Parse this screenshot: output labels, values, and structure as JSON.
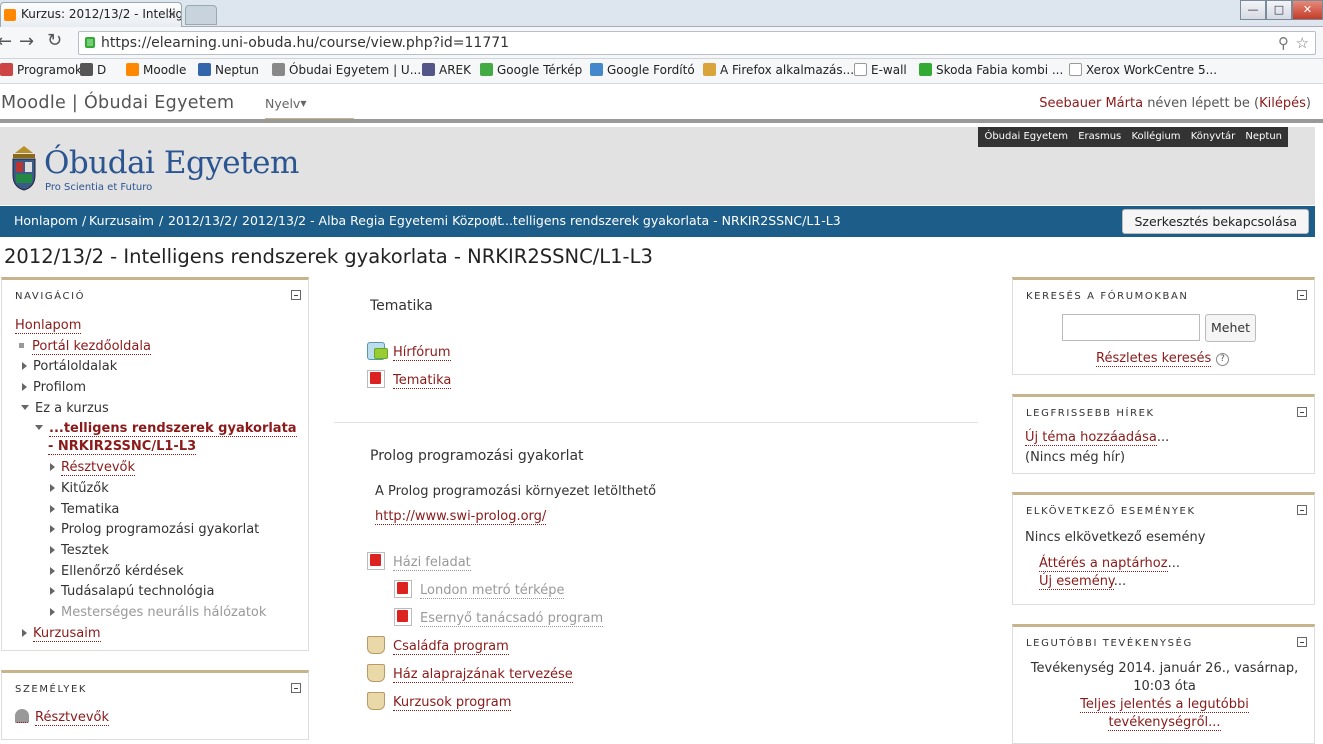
{
  "browser": {
    "tab_title": "Kurzus: 2012/13/2 - Intellig",
    "tab_close": "×",
    "url": "https://elearning.uni-obuda.hu/course/view.php?id=11771",
    "window_buttons": [
      "—",
      "□",
      "✕"
    ],
    "bookmarks": [
      {
        "label": "Programok",
        "color": "#c44"
      },
      {
        "label": "D",
        "color": "#555"
      },
      {
        "label": "Moodle",
        "color": "#f80"
      },
      {
        "label": "Neptun",
        "color": "#36a"
      },
      {
        "label": "Óbudai Egyetem | U...",
        "color": "#888"
      },
      {
        "label": "AREK",
        "color": "#558"
      },
      {
        "label": "Google Térkép",
        "color": "#4a4"
      },
      {
        "label": "Google Fordító",
        "color": "#48c"
      },
      {
        "label": "A Firefox alkalmazás...",
        "color": "#d9a53a"
      },
      {
        "label": "E-wall",
        "color": "#ccc"
      },
      {
        "label": "Skoda Fabia kombi ...",
        "color": "#3a3"
      },
      {
        "label": "Xerox WorkCentre 5...",
        "color": "#ccc"
      }
    ]
  },
  "header": {
    "site_title": "Moodle | Óbudai Egyetem",
    "language": "Nyelv",
    "user_name": "Seebauer Márta",
    "logged_in_text": "néven lépett be (",
    "logout": "Kilépés",
    "logout_close": ")"
  },
  "toplinks": [
    "Óbudai Egyetem",
    "Erasmus",
    "Kollégium",
    "Könyvtár",
    "Neptun"
  ],
  "logo": {
    "name": "Óbudai Egyetem",
    "motto": "Pro Scientia et Futuro"
  },
  "breadcrumb": [
    "Honlapom",
    "Kurzusaim",
    "2012/13/2",
    "2012/13/2 - Alba Regia Egyetemi Központ",
    "...telligens rendszerek gyakorlata - NRKIR2SSNC/L1-L3"
  ],
  "edit_button": "Szerkesztés bekapcsolása",
  "page_title": "2012/13/2 - Intelligens rendszerek gyakorlata - NRKIR2SSNC/L1-L3",
  "navigation": {
    "title": "NAVIGÁCIÓ",
    "home": "Honlapom",
    "portal": "Portál kezdőoldala",
    "portal_pages": "Portáloldalak",
    "profile": "Profilom",
    "this_course": "Ez a kurzus",
    "course_line1": "...telligens rendszerek gyakorlata",
    "course_line2": "- NRKIR2SSNC/L1-L3",
    "items": [
      "Résztvevők",
      "Kitűzők",
      "Tematika",
      "Prolog programozási gyakorlat",
      "Tesztek",
      "Ellenőrző kérdések",
      "Tudásalapú technológia",
      "Mesterséges neurális hálózatok"
    ],
    "my_courses": "Kurzusaim"
  },
  "people": {
    "title": "SZEMÉLYEK",
    "participants": "Résztvevők"
  },
  "main": {
    "section1_title": "Tematika",
    "section1_items": [
      "Hírfórum",
      "Tematika"
    ],
    "section2_title": "Prolog programozási gyakorlat",
    "section2_text": "A Prolog programozási környezet letölthető",
    "section2_link": "http://www.swi-prolog.org/",
    "homework": "Házi feladat",
    "homework_sub": [
      "London metró térképe",
      "Esernyő tanácsadó program"
    ],
    "programs": [
      "Családfa program",
      "Ház alaprajzának tervezése",
      "Kurzusok program"
    ]
  },
  "search_forums": {
    "title": "KERESÉS A FÓRUMOKBAN",
    "button": "Mehet",
    "advanced": "Részletes keresés",
    "help": "?"
  },
  "news": {
    "title": "LEGFRISSEBB HÍREK",
    "add": "Új téma hozzáadása",
    "add_suffix": "...",
    "none": "(Nincs még hír)"
  },
  "events": {
    "title": "ELKÖVETKEZŐ ESEMÉNYEK",
    "none": "Nincs elkövetkező esemény",
    "calendar": "Áttérés a naptárhoz",
    "calendar_suffix": "...",
    "new_event": "Új esemény",
    "new_event_suffix": "..."
  },
  "activity": {
    "title": "LEGUTÓBBI TEVÉKENYSÉG",
    "since_line1": "Tevékenység 2014. január 26., vasárnap,",
    "since_line2": "10:03 óta",
    "full_report_line1": "Teljes jelentés a legutóbbi",
    "full_report_line2": "tevékenységről..."
  }
}
